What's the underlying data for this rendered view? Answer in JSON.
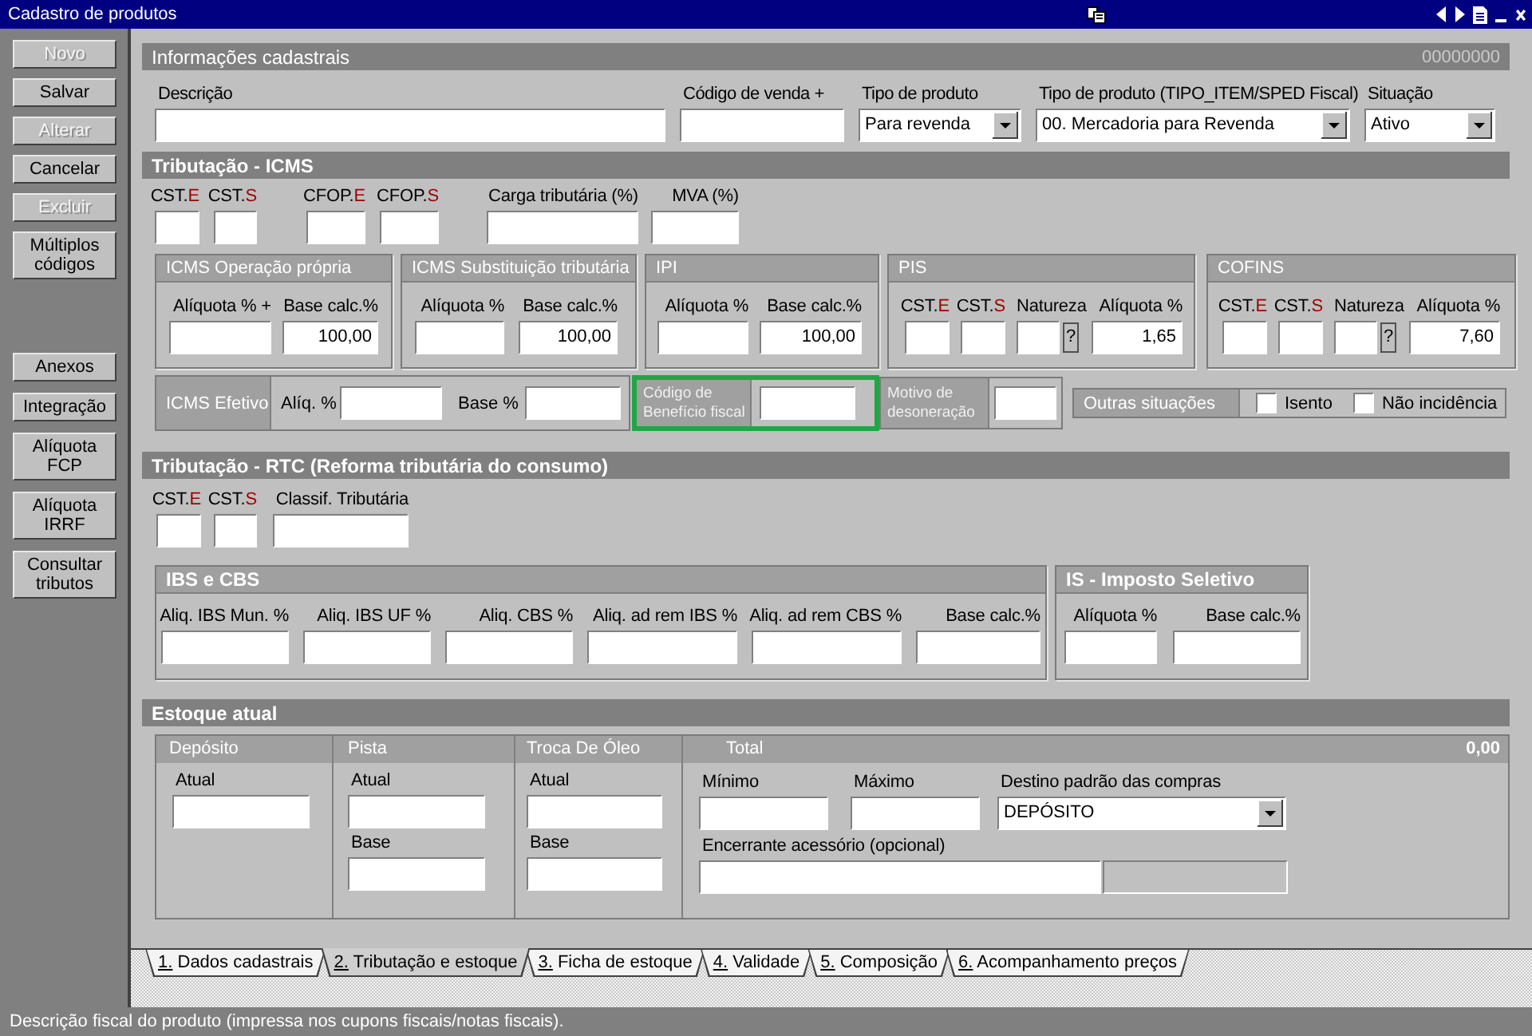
{
  "window": {
    "title": "Cadastro de produtos"
  },
  "sidebar": {
    "top_buttons": [
      {
        "label": "Novo",
        "disabled": true
      },
      {
        "label": "Salvar",
        "disabled": false
      },
      {
        "label": "Alterar",
        "disabled": true
      },
      {
        "label": "Cancelar",
        "disabled": false
      },
      {
        "label": "Excluir",
        "disabled": true
      },
      {
        "label": "Múltiplos códigos",
        "disabled": false
      }
    ],
    "bottom_buttons": [
      {
        "label": "Anexos",
        "disabled": false
      },
      {
        "label": "Integração",
        "disabled": false
      },
      {
        "label": "Alíquota FCP",
        "disabled": false
      },
      {
        "label": "Alíquota IRRF",
        "disabled": false
      },
      {
        "label": "Consultar tributos",
        "disabled": false
      }
    ]
  },
  "cadastrais": {
    "title": "Informações cadastrais",
    "record_code": "00000000",
    "fields": [
      {
        "kind": "input",
        "label": "Descrição"
      },
      {
        "kind": "input",
        "label": "Código de venda +"
      },
      {
        "kind": "select",
        "label": "Tipo de produto",
        "value": "Para revenda"
      },
      {
        "kind": "select",
        "label": "Tipo de produto (TIPO_ITEM/SPED Fiscal)",
        "value": "00. Mercadoria para Revenda"
      },
      {
        "kind": "select",
        "label": "Situação",
        "value": "Ativo"
      }
    ]
  },
  "icms": {
    "title": "Tributação - ICMS",
    "fields": [
      {
        "label": "CST.",
        "suffix": "E"
      },
      {
        "label": "CST.",
        "suffix": "S"
      },
      {
        "label": "CFOP.",
        "suffix": "E"
      },
      {
        "label": "CFOP.",
        "suffix": "S"
      },
      {
        "label": "Carga tributária (%)"
      },
      {
        "label": "MVA (%)"
      }
    ],
    "groups": [
      {
        "title": "ICMS Operação própria",
        "fields": [
          {
            "label": "Alíquota % +"
          },
          {
            "label": "Base calc.%",
            "value": "100,00"
          }
        ]
      },
      {
        "title": "ICMS Substituição tributária",
        "fields": [
          {
            "label": "Alíquota %"
          },
          {
            "label": "Base calc.%",
            "value": "100,00"
          }
        ]
      },
      {
        "title": "IPI",
        "fields": [
          {
            "label": "Alíquota %"
          },
          {
            "label": "Base calc.%",
            "value": "100,00"
          }
        ]
      },
      {
        "title": "PIS",
        "fields": [
          {
            "kind": "input",
            "label": "CST.",
            "suffix": "E"
          },
          {
            "kind": "input",
            "label": "CST.",
            "suffix": "S"
          },
          {
            "kind": "lookup",
            "label": "Natureza",
            "help": "?"
          },
          {
            "kind": "input",
            "label": "Alíquota %",
            "value": "1,65"
          }
        ]
      },
      {
        "title": "COFINS",
        "fields": [
          {
            "kind": "input",
            "label": "CST.",
            "suffix": "E"
          },
          {
            "kind": "input",
            "label": "CST.",
            "suffix": "S"
          },
          {
            "kind": "lookup",
            "label": "Natureza",
            "help": "?"
          },
          {
            "kind": "input",
            "label": "Alíquota %",
            "value": "7,60"
          }
        ]
      }
    ],
    "effective": {
      "title": "ICMS Efetivo",
      "fields": [
        {
          "label": "Alíq. %"
        },
        {
          "label": "Base %"
        }
      ]
    },
    "benefit_code": {
      "label": "Código de Benefício fiscal",
      "highlighted": true
    },
    "exemption_reason": {
      "label": "Motivo de desoneração"
    },
    "other_situations": {
      "title": "Outras situações",
      "options": [
        {
          "label": "Isento",
          "checked": false
        },
        {
          "label": "Não incidência",
          "checked": false
        }
      ]
    }
  },
  "rtc": {
    "title": "Tributação - RTC (Reforma tributária do consumo)",
    "fields": [
      {
        "label": "CST.",
        "suffix": "E"
      },
      {
        "label": "CST.",
        "suffix": "S"
      },
      {
        "label": "Classif. Tributária"
      }
    ],
    "groups": [
      {
        "title": "IBS e CBS",
        "fields": [
          {
            "label": "Aliq. IBS Mun. %"
          },
          {
            "label": "Aliq. IBS UF %"
          },
          {
            "label": "Aliq. CBS %"
          },
          {
            "label": "Aliq. ad rem IBS %"
          },
          {
            "label": "Aliq. ad rem CBS %"
          },
          {
            "label": "Base calc.%"
          }
        ]
      },
      {
        "title": "IS - Imposto Seletivo",
        "fields": [
          {
            "label": "Alíquota %"
          },
          {
            "label": "Base calc.%"
          }
        ]
      }
    ]
  },
  "stock": {
    "title": "Estoque atual",
    "columns": [
      {
        "title": "Depósito",
        "fields": [
          {
            "label": "Atual"
          }
        ]
      },
      {
        "title": "Pista",
        "fields": [
          {
            "label": "Atual"
          },
          {
            "label": "Base"
          }
        ]
      },
      {
        "title": "Troca De Óleo",
        "fields": [
          {
            "label": "Atual"
          },
          {
            "label": "Base"
          }
        ]
      }
    ],
    "total": {
      "title": "Total",
      "value": "0,00",
      "rows": [
        [
          {
            "kind": "input",
            "label": "Mínimo"
          },
          {
            "kind": "input",
            "label": "Máximo"
          },
          {
            "kind": "select",
            "label": "Destino padrão das compras",
            "value": "DEPÓSITO"
          }
        ],
        [
          {
            "kind": "input",
            "label": "Encerrante acessório (opcional)"
          },
          {
            "kind": "readonly"
          }
        ]
      ]
    }
  },
  "tabs": [
    {
      "label": "1. Dados cadastrais",
      "selected": false
    },
    {
      "label": "2. Tributação e estoque",
      "selected": true
    },
    {
      "label": "3. Ficha de estoque",
      "selected": false
    },
    {
      "label": "4. Validade",
      "selected": false
    },
    {
      "label": "5. Composição",
      "selected": false
    },
    {
      "label": "6. Acompanhamento preços",
      "selected": false
    }
  ],
  "status_bar": {
    "text": "Descrição fiscal do produto (impressa nos cupons fiscais/notas fiscais)."
  }
}
